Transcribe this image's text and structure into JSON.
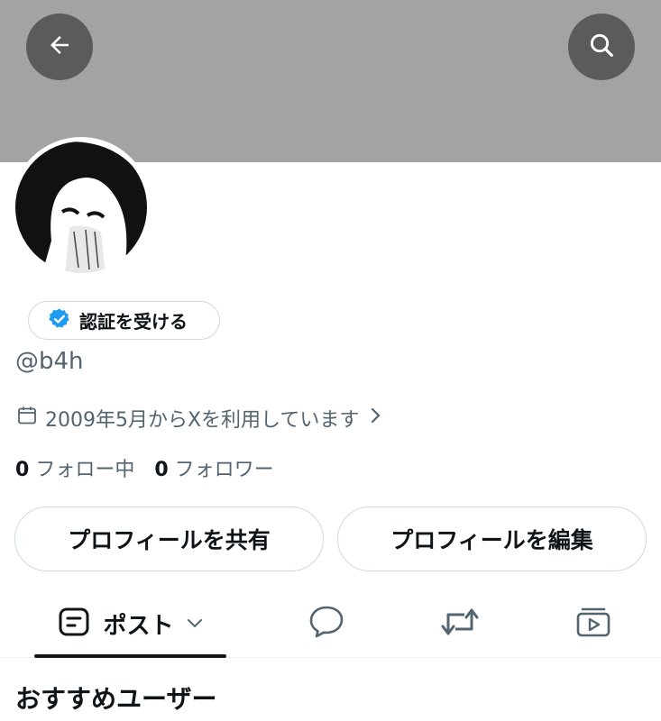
{
  "header": {
    "back_icon": "back-arrow-icon",
    "search_icon": "search-icon",
    "banner_color": "#a3a3a3",
    "button_color": "#5b5b5b"
  },
  "profile": {
    "avatar": "manga-girl-avatar",
    "verify_label": "認証を受ける",
    "verify_icon": "verified-badge-icon",
    "verify_color": "#1d9bf0",
    "handle": "@b4h",
    "joined_text": "2009年5月からXを利用しています",
    "following_count": "0",
    "following_label": "フォロー中",
    "followers_count": "0",
    "followers_label": "フォロワー"
  },
  "actions": {
    "share_label": "プロフィールを共有",
    "edit_label": "プロフィールを編集"
  },
  "tabs": {
    "posts_label": "ポスト",
    "posts_icon": "posts-icon",
    "replies_icon": "reply-bubble-icon",
    "reposts_icon": "repost-icon",
    "media_icon": "media-icon"
  },
  "section": {
    "title": "おすすめユーザー"
  }
}
